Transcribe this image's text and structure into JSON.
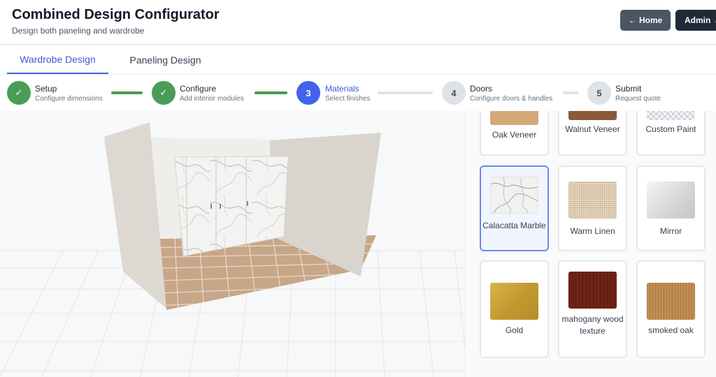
{
  "header": {
    "title": "Combined Design Configurator",
    "subtitle": "Design both paneling and wardrobe",
    "home_button": "← Home",
    "admin_button": "Admin →"
  },
  "tabs": [
    {
      "label": "Wardrobe Design",
      "active": true
    },
    {
      "label": "Paneling Design",
      "active": false
    }
  ],
  "steps": [
    {
      "number": "1",
      "icon": "check-icon",
      "title": "Setup",
      "desc": "Configure dimensions",
      "state": "done"
    },
    {
      "number": "2",
      "icon": "check-icon",
      "title": "Configure",
      "desc": "Add interior modules",
      "state": "done"
    },
    {
      "number": "3",
      "title": "Materials",
      "desc": "Select finishes",
      "state": "current"
    },
    {
      "number": "4",
      "title": "Doors",
      "desc": "Configure doors & handles",
      "state": "todo"
    },
    {
      "number": "5",
      "title": "Submit",
      "desc": "Request quote",
      "state": "todo"
    }
  ],
  "step_check_glyph": "✓",
  "materials": [
    {
      "label": "Oak Veneer",
      "swatch": "oak-veneer-swatch",
      "color": "#d3a878",
      "selected": false
    },
    {
      "label": "Walnut Veneer",
      "swatch": "walnut-veneer-swatch",
      "color": "#8a5a3b",
      "selected": false
    },
    {
      "label": "Custom Paint",
      "swatch": "custom-paint-swatch",
      "color": "#e5e7eb",
      "selected": false
    },
    {
      "label": "Calacatta Marble",
      "swatch": "marble-swatch",
      "color": "#f1f1ef",
      "selected": true
    },
    {
      "label": "Warm Linen",
      "swatch": "linen-swatch",
      "color": "#e6d8bf",
      "selected": false
    },
    {
      "label": "Mirror",
      "swatch": "mirror-swatch",
      "color": "#d9dadb",
      "selected": false
    },
    {
      "label": "Gold",
      "swatch": "gold-swatch",
      "color": "#c9a43a",
      "selected": false
    },
    {
      "label": "mahogany wood texture",
      "swatch": "mahogany-swatch",
      "color": "#6e2414",
      "selected": false
    },
    {
      "label": "smoked oak",
      "swatch": "smoked-oak-swatch",
      "color": "#c08e52",
      "selected": false
    }
  ],
  "colors": {
    "accent": "#4263eb",
    "done": "#4a9d54",
    "floor": "#c8a688",
    "panel": "#ddd8d2"
  }
}
